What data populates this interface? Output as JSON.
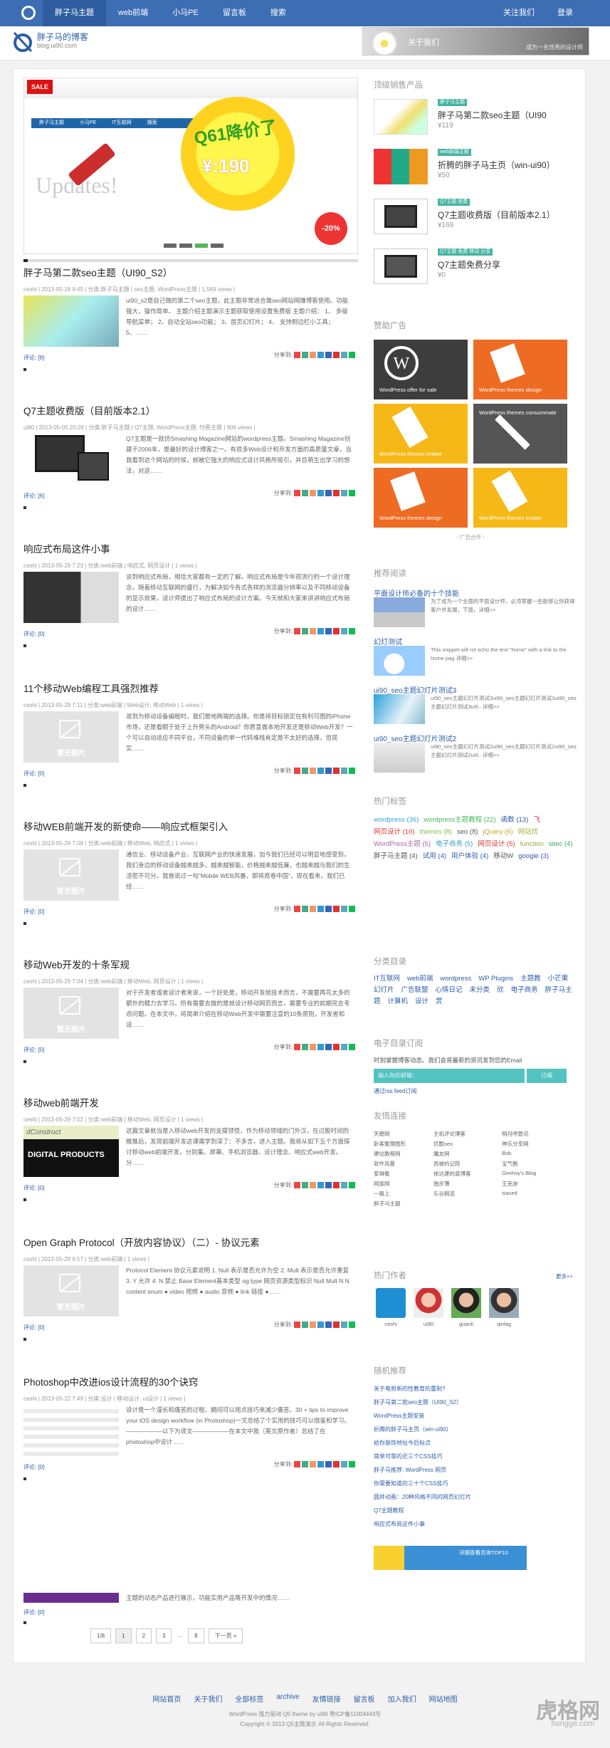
{
  "topnav": {
    "items": [
      "胖子马主题",
      "web前端",
      "小马PE",
      "留言板",
      "搜索"
    ],
    "right": [
      "关注我们",
      "登录"
    ]
  },
  "header": {
    "site_name": "胖子马的博客",
    "site_url": "blog.ui90.com",
    "banner_title": "关于我们",
    "banner_sub": "成为一名优秀的设计师"
  },
  "slider": {
    "sale": "SALE",
    "headline": "Q61降价了",
    "price": "¥:190",
    "updates": "Updates!",
    "percent": "-20%",
    "nav": [
      "胖子马主题",
      "小马PE",
      "IT互联网",
      "搜索"
    ]
  },
  "posts": [
    {
      "title": "胖子马第二款seo主题（UI90_S2）",
      "meta": "ceshi | 2013-05-18 9:45 | 分类:胖子马主题 | seo主题, WordPress主题 | 1,569 views |",
      "excerpt": "ui90_s2是自己做的第二个seo主题，此主题非常适合做seo网站网赚博客使用。功能强大，操作简单。 主题介绍主题演示主题获取使用设置免费版 主题介绍： 1、 多级导航菜单； 2、自动全站seo功能； 3、首页幻灯片； 4、 支持侧边栏小工具； 5、……",
      "comments": "评论: [8]",
      "share": "分享到:"
    },
    {
      "title": "Q7主题收费版（目前版本2.1）",
      "meta": "ui90 | 2013-05-05 20:26 | 分类:胖子马主题 | Q7主题, WordPress主题, 付费主题 | 906 views |",
      "excerpt": "Q7主题是一款仿Smashing Magazine网站的wordpress主题。Smashing Magazine创建于2006年，是最好的设计博客之一。有很多Web设计和开发方面的高质量文章，当我看到这个网站的时候，就被它强大的响应式设计风格所吸引，并且萌生出学习的想法，对这……",
      "comments": "评论: [6]",
      "share": "分享到:"
    },
    {
      "title": "响应式布局这件小事",
      "meta": "ceshi | 2013-05-29 7:23 | 分类:web前端 | 响应式, 网页设计 | 1 views |",
      "excerpt": "谈到响应式布局，相信大家都有一定的了解。响应式布局是今年很流行的一个设计理念，随着移动互联网的盛行，为解决如今各式各样的浏览器分辨率以及不同移动设备的显示效果，设计师提出了响应式布局的设计方案。今天就和大家来讲讲响应式布局的设计……",
      "comments": "评论: [0]",
      "share": "分享到:"
    },
    {
      "title": "11个移动Web编程工具强烈推荐",
      "meta": "ceshi | 2013-05-29 7:11 | 分类:web前端 | Web设计, 移动Web | 1 views |",
      "excerpt": "说到为移动设备编程时，我们是地两端的选择。你是将目标锁定在有利可图的iPhone市场，还是看眼于处于上升势头的Android？你愿意做本地开发还是移动Web开发？一个可以自动适应不同平台，不同设备的单一代码堆栈肯定是不太好的选择，但现实……",
      "comments": "评论: [0]",
      "share": "分享到:",
      "placeholder": "暂无图片"
    },
    {
      "title": "移动WEB前端开发的新使命——响应式框架引入",
      "meta": "ceshi | 2013-05-29 7:08 | 分类:web前端 | 移动Web, 响应式 | 1 views |",
      "excerpt": "通信业、移动设备产业、互联网产业的快速发展，加今我们已经可以明显地感受到，我们身边的移动设备越来越多，越来越智能，价格越来越低廉，也越来越与我们的生活密不可分。我曾说过一句“Mobile WEB风暴，即将席卷中国”，现在看来，我们已经……",
      "comments": "评论: [0]",
      "share": "分享到:",
      "placeholder": "暂无图片"
    },
    {
      "title": "移动Web开发的十条军规",
      "meta": "ceshi | 2013-05-29 7:04 | 分类:web前端 | 移动Web, 网页设计 | 1 views |",
      "excerpt": "对于开发者或者设计者来说，一个好处是，移动开发就技术而言，不需要再花太多的额外的精力去学习。所有需要去做的是就设计移动网页而言，需要专业的前期完去考虑问题。在本文中，将简单介绍在移动Web开发中需要注意的10条原则，开发者和设……",
      "comments": "评论: [0]",
      "share": "分享到:",
      "placeholder": "暂无图片"
    },
    {
      "title": "移动web前端开发",
      "meta": "ceshi | 2013-05-29 7:02 | 分类:web前端 | 移动Web, 网页设计 | 1 views |",
      "excerpt": "这篇文章就当是入移动web开发的支撑领悟，作为移动领域的门外汉，在过股时间的推推后，发现前端开发这课需学到深了：不多言，进入主题。我将从如下五个方面探讨移动web前端开发，分别集、屏幕、手机浏览器、设计理念、响应式web开发。分……",
      "comments": "评论: [0]",
      "share": "分享到:",
      "thumb_title": "dConstruct",
      "thumb_sub": "DIGITAL PRODUCTS"
    },
    {
      "title": "Open Graph Protocol（开放内容协议）（二）- 协议元素",
      "meta": "ceshi | 2013-05-29 6:57 | 分类:web前端 | 1 views |",
      "excerpt": "Protocol Element 协议元素说明 1. Null 表示是否允许为空 2. Mult 表示是否允许重复 3. Y 允许 4. N 禁止 Base Element基本类型 og:type 网页资源类型标识 Null Mult N N content enum ● video 视频 ● audio 音频 ● link 链接 ●……",
      "comments": "评论: [0]",
      "share": "分享到:",
      "placeholder": "暂无图片"
    },
    {
      "title": "Photoshop中改进ios设计流程的30个诀窍",
      "meta": "ceshi | 2013-05-22 7:49 | 分类:设计 | 移动设计, ui设计 | 1 views |",
      "excerpt": "设计是一个漫长和痛苦的过程。期间可以用点技巧来减少痛苦。30 + tips to improve your iOS design workflow (in Photoshop)一文总结了个实用的技巧可以借鉴和学习。——————以下为译文——————在本文中我（英文原作者）总结了在photoshop中设计……",
      "comments": "评论: [0]",
      "share": "分享到:"
    }
  ],
  "post_last": {
    "excerpt": "主题的动态产品进行展示，功能实用产品等开发中的情况……",
    "comments": "评论: [0]"
  },
  "pager": [
    "1/8",
    "1",
    "2",
    "3",
    "...",
    "8",
    "下一页 »"
  ],
  "sidebar": {
    "top_title": "顶级销售产品",
    "products": [
      {
        "tag": "胖子马主题",
        "name": "胖子马第二款seo主题（UI90",
        "price": "¥119"
      },
      {
        "tag": "web前端主题",
        "name": "折腾的胖子马主页（win-ui90）",
        "price": "¥50"
      },
      {
        "tag": "Q7主题 收费",
        "name": "Q7主题收费版（目前版本2.1）",
        "price": "¥169"
      },
      {
        "tag": "Q7主题 免费 移动 分享",
        "name": "Q7主题免费分享",
        "price": "¥0"
      }
    ],
    "ad_title": "赞助广告",
    "ads": [
      "WordPress offer for sale",
      "WordPress themes design",
      "WordPress themes consummate",
      "WordPress themes imitate",
      "WordPress themes design",
      "WordPress themes imitate"
    ],
    "ad_cooperate": "- 广告合作 -",
    "rec_title": "推荐阅读",
    "recs": [
      {
        "title": "平面设计师必备的十个技能",
        "desc": "为了成为一个全面的平面设计师，必须掌握一些能够让你获得客户并发展，下面，详细>>"
      },
      {
        "title": "幻灯测试",
        "desc": "This snippet will rot echo the text \"home\" with a link to the home pag 详细>>"
      },
      {
        "title": "ui90_seo主题幻灯片测试3",
        "desc": "ui90_seo主题幻灯片测试3ui90_seo主题幻灯片测试3ui90_seo主题幻灯片测试3ui9.. 详细>>"
      },
      {
        "title": "ui90_seo主题幻灯片测试2",
        "desc": "ui90_seo主题幻灯片测试2ui90_seo主题幻灯片测试2ui90_seo主题幻灯片测试2ui9.. 详细>>"
      }
    ],
    "tags_title": "热门标签",
    "tags": [
      {
        "t": "wordpress (36)",
        "c": "#39a2c8"
      },
      {
        "t": "wordpress主题教程 (22)",
        "c": "#46b85a"
      },
      {
        "t": "函数 (13)",
        "c": "#2b5ea9"
      },
      {
        "t": "飞",
        "c": "#d33"
      },
      {
        "t": "网页设计 (10)",
        "c": "#d33"
      },
      {
        "t": "themes (8)",
        "c": "#8b5"
      },
      {
        "t": "seo (8)",
        "c": "#555"
      },
      {
        "t": "jQuery (6)",
        "c": "#c7a520"
      },
      {
        "t": "网站优",
        "c": "#aa4"
      },
      {
        "t": "WordPress主题 (5)",
        "c": "#a6a"
      },
      {
        "t": "电子商务 (5)",
        "c": "#39a2c8"
      },
      {
        "t": "网页设计 (5)",
        "c": "#d33"
      },
      {
        "t": "function",
        "c": "#9a4"
      },
      {
        "t": "sitec (4)",
        "c": "#3a6"
      },
      {
        "t": "胖子马主题 (4)",
        "c": "#555"
      },
      {
        "t": "试用 (4)",
        "c": "#2b5ea9"
      },
      {
        "t": "用户体验 (4)",
        "c": "#2b5ea9"
      },
      {
        "t": "移动W",
        "c": "#555"
      },
      {
        "t": "google (3)",
        "c": "#2b5ea9"
      }
    ],
    "cat_title": "分类目录",
    "cats": [
      "IT互联网",
      "web前端",
      "wordpress",
      "WP Plugins",
      "主题教",
      "小芒果",
      "幻灯片",
      "广告联盟",
      "心情日记",
      "未分类",
      "欣",
      "电子商务",
      "胖子马主题",
      "计算机",
      "设计",
      "赏"
    ],
    "sub_title": "电子目录订阅",
    "sub_desc": "时刻掌握博客动态。我们会将最新的资讯发到您的Email",
    "sub_placeholder": "输入你的邮箱：",
    "sub_btn": "订阅",
    "sub_rss": "通过rss feed订阅",
    "links_title": "友情连接",
    "links": [
      "天磨网",
      "主机评论博客",
      "明月呼嚣讯",
      "卧客整理图形",
      "优酷seo",
      "神乐分享网",
      "建站教程网",
      "魔友网",
      "Bob",
      "软件风暴",
      "西坡的记院",
      "宝气鲍",
      "爱琳敬",
      "徐达建的装博客",
      "Gimhoy's Blog",
      "网族网",
      "独步薄",
      "王克迪",
      "一路上",
      "乐谷精选",
      "isaced",
      "胖子马主题"
    ],
    "auth_title": "热门作者",
    "auth_more": "更多>>",
    "authors": [
      "ceshi",
      "ui90",
      "guanli",
      "qinlag"
    ],
    "rand_title": "随机推荐",
    "rands": [
      "关于电剪新的性教育的重制?",
      "胖子马第二款seo主题（UI90_S2）",
      "WordPress主题安装",
      "折腾的胖子马主页（win-ui90）",
      "给你装饰地址今后标点",
      "简单可靠的近三个CSS技巧",
      "胖子马推荐: WordPress 网页",
      "你需要知道的三十个CSS技巧",
      "圆井动画：20种风格不同的网页幻灯片",
      "Q7主题教程",
      "响应式布局这件小事"
    ],
    "banner_text": "详细查看咨询TOP10"
  },
  "footer": {
    "links": [
      "网站首页",
      "关于我们",
      "全部标签",
      "archive",
      "友情链接",
      "留言板",
      "加入我们",
      "网站地图"
    ],
    "powered": "WordPress 强力驱动  Q5 theme by  ui90  粤ICP备11004443号",
    "copyright": "Copyright © 2013  Q5主题演示  All Rights Reserved.",
    "wm": "虎格网",
    "wm_url": "hongge.com"
  }
}
